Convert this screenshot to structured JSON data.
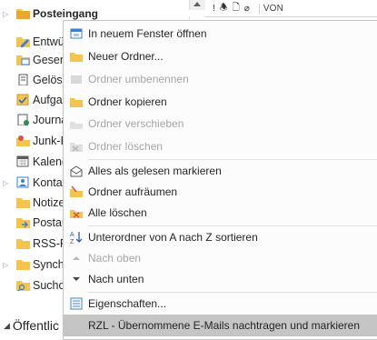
{
  "folders": [
    {
      "label": "Posteingang",
      "icon": "inbox-folder-icon",
      "bold": true,
      "expander": "▷"
    },
    {
      "label": "Entwür",
      "icon": "drafts-folder-icon"
    },
    {
      "label": "Gesend",
      "icon": "sent-folder-icon"
    },
    {
      "label": "Gelösc",
      "icon": "deleted-folder-icon"
    },
    {
      "label": "Aufgab",
      "icon": "tasks-folder-icon"
    },
    {
      "label": "Journa",
      "icon": "journal-folder-icon"
    },
    {
      "label": "Junk-E",
      "icon": "junk-folder-icon"
    },
    {
      "label": "Kalend",
      "icon": "calendar-folder-icon"
    },
    {
      "label": "Kontak",
      "icon": "contacts-folder-icon",
      "expander": "▷"
    },
    {
      "label": "Notize",
      "icon": "notes-folder-icon"
    },
    {
      "label": "Postau",
      "icon": "outbox-folder-icon"
    },
    {
      "label": "RSS-Fe",
      "icon": "rss-folder-icon"
    },
    {
      "label": "Synchr",
      "icon": "sync-folder-icon",
      "expander": "▷"
    },
    {
      "label": "Suchor",
      "icon": "search-folder-icon"
    }
  ],
  "section_label": "Öffentlic",
  "mail_list": {
    "from_header": "VON"
  },
  "menu": {
    "items": [
      {
        "label": "In neuem Fenster öffnen",
        "icon": "new-window-icon",
        "disabled": false
      },
      {
        "label": "Neuer Ordner...",
        "icon": "new-folder-icon",
        "disabled": false
      },
      {
        "label": "Ordner umbenennen",
        "icon": "rename-folder-icon",
        "disabled": true
      },
      {
        "label": "Ordner kopieren",
        "icon": "copy-folder-icon",
        "disabled": false
      },
      {
        "label": "Ordner verschieben",
        "icon": "move-folder-icon",
        "disabled": true
      },
      {
        "label": "Ordner löschen",
        "icon": "delete-folder-icon",
        "disabled": true
      },
      {
        "label": "Alles als gelesen markieren",
        "icon": "mark-read-icon",
        "disabled": false
      },
      {
        "label": "Ordner aufräumen",
        "icon": "cleanup-folder-icon",
        "disabled": false
      },
      {
        "label": "Alle löschen",
        "icon": "delete-all-icon",
        "disabled": false
      },
      {
        "label": "Unterordner von A nach Z sortieren",
        "icon": "sort-az-icon",
        "disabled": false
      },
      {
        "label": "Nach oben",
        "icon": "move-up-icon",
        "disabled": true
      },
      {
        "label": "Nach unten",
        "icon": "move-down-icon",
        "disabled": false
      },
      {
        "label": "Eigenschaften...",
        "icon": "properties-icon",
        "disabled": false
      },
      {
        "label": "RZL - Übernommene E-Mails nachtragen und markieren",
        "icon": "",
        "disabled": false,
        "highlighted": true
      }
    ]
  },
  "colors": {
    "folder_yellow": "#f4c44e",
    "highlight": "#c5c5c5",
    "disabled_text": "#a6a6a6"
  }
}
